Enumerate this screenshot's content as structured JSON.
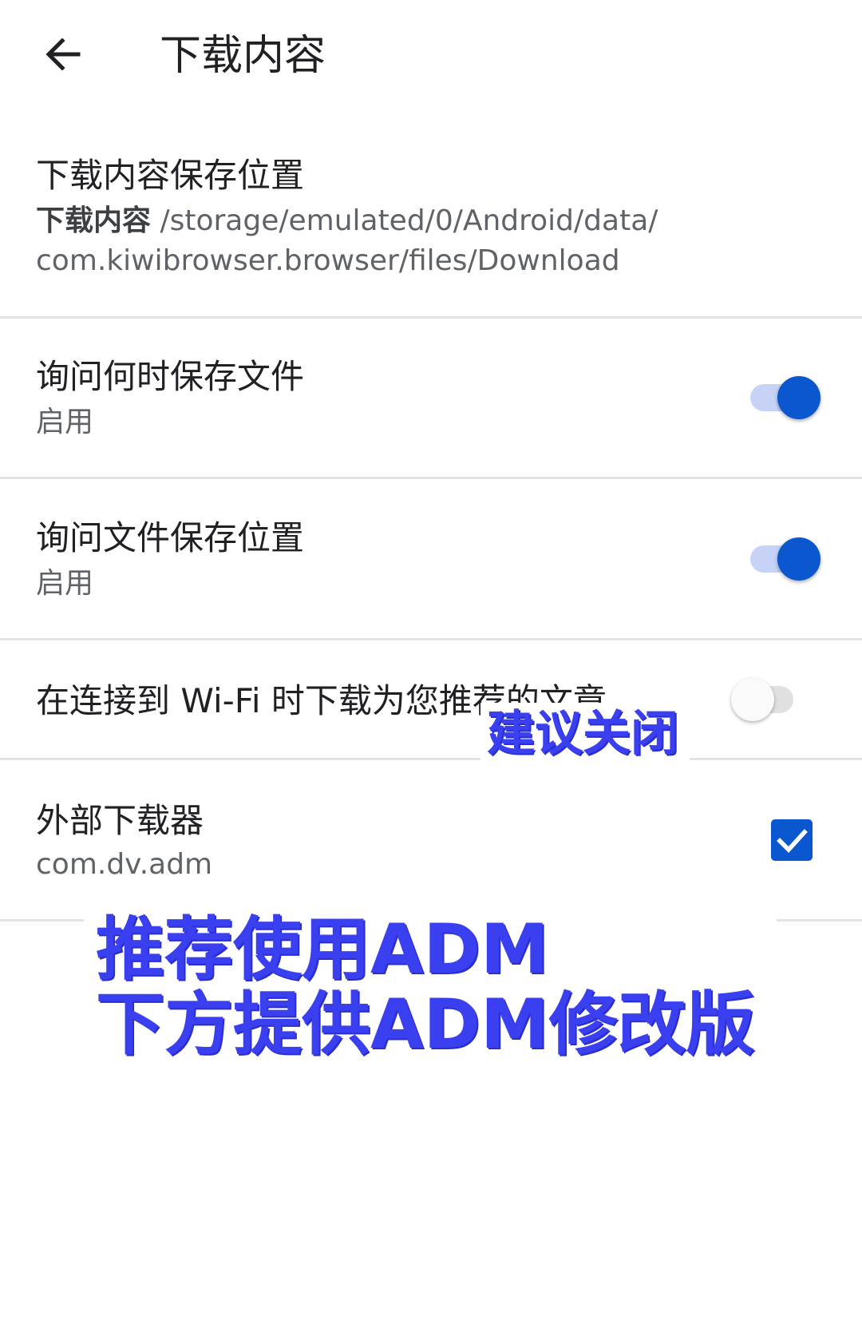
{
  "header": {
    "title": "下载内容",
    "back_icon": "arrow-back-icon"
  },
  "settings": {
    "location": {
      "title": "下载内容保存位置",
      "path_label": "下载内容",
      "path_line1": " /storage/emulated/0/Android/data/",
      "path_line2": "com.kiwibrowser.browser/files/Download"
    },
    "ask_when": {
      "title": "询问何时保存文件",
      "status": "启用",
      "enabled": true
    },
    "ask_where": {
      "title": "询问文件保存位置",
      "status": "启用",
      "enabled": true
    },
    "wifi": {
      "title": "在连接到 Wi-Fi 时下载为您推荐的文章",
      "enabled": false
    },
    "external": {
      "title": "外部下载器",
      "package": "com.dv.adm",
      "checked": true
    }
  },
  "annotations": {
    "small": "建议关闭",
    "big_line1": "推荐使用ADM",
    "big_line2": "下方提供ADM修改版"
  },
  "colors": {
    "accent": "#0b57d0",
    "annotation": "#3a3ff0"
  }
}
